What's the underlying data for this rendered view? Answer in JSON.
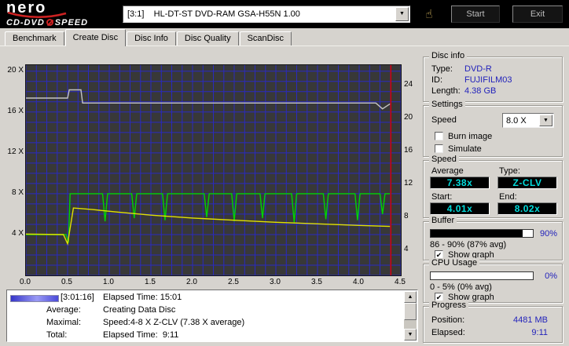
{
  "header": {
    "logo": {
      "name": "nero",
      "product_left": "CD-DVD",
      "product_right": "SPEED"
    },
    "drive_select": {
      "value": "[3:1]    HL-DT-ST DVD-RAM GSA-H55N 1.00"
    },
    "start_button": "Start",
    "exit_button": "Exit"
  },
  "icons": {
    "dropdown_arrow": "▼",
    "scroll_up": "▲",
    "scroll_down": "▼",
    "check": "✔",
    "hand": "☝"
  },
  "tabs": [
    {
      "label": "Benchmark",
      "active": false
    },
    {
      "label": "Create Disc",
      "active": true
    },
    {
      "label": "Disc Info",
      "active": false
    },
    {
      "label": "Disc Quality",
      "active": false
    },
    {
      "label": "ScanDisc",
      "active": false
    }
  ],
  "chart_data": {
    "type": "line",
    "title": "",
    "x_axis": {
      "min": 0,
      "max": 4.5,
      "step_labels": [
        0,
        0.5,
        1,
        1.5,
        2,
        2.5,
        3,
        3.5,
        4,
        4.5
      ],
      "unit": "GB"
    },
    "y_left": {
      "min": 0,
      "max": 20.6,
      "ticks": [
        20,
        16,
        12,
        8,
        4
      ],
      "suffix": " X"
    },
    "y_right": {
      "min": 1,
      "max": 26.5,
      "ticks": [
        24,
        20,
        16,
        12,
        8,
        4
      ]
    },
    "grid": {
      "x_step": 0.125,
      "y_step": 1,
      "color": "#2a2ac0"
    },
    "cursor_x": 4.38,
    "cursor_color": "#d40000",
    "series": [
      {
        "name": "buffer-level",
        "axis": "right",
        "color": "#c4c4c4",
        "points": [
          [
            0,
            22.5
          ],
          [
            0.5,
            22.5
          ],
          [
            0.52,
            23.5
          ],
          [
            0.66,
            23.5
          ],
          [
            0.68,
            21.9
          ],
          [
            4.2,
            21.9
          ],
          [
            4.28,
            21.2
          ],
          [
            4.37,
            21.8
          ]
        ]
      },
      {
        "name": "write-speed",
        "axis": "left",
        "color": "#00d400",
        "points": [
          [
            0,
            4
          ],
          [
            0.48,
            4
          ],
          [
            0.51,
            3.2
          ],
          [
            0.53,
            8
          ],
          [
            0.92,
            8
          ],
          [
            0.95,
            5.3
          ],
          [
            0.98,
            8
          ],
          [
            1.27,
            8
          ],
          [
            1.3,
            5.6
          ],
          [
            1.33,
            8
          ],
          [
            1.64,
            8
          ],
          [
            1.67,
            5.4
          ],
          [
            1.7,
            8
          ],
          [
            2.14,
            8
          ],
          [
            2.17,
            5.7
          ],
          [
            2.2,
            8
          ],
          [
            2.47,
            8
          ],
          [
            2.5,
            5.3
          ],
          [
            2.53,
            8
          ],
          [
            2.81,
            8
          ],
          [
            2.84,
            5.6
          ],
          [
            2.87,
            8
          ],
          [
            3.19,
            8
          ],
          [
            3.22,
            5.2
          ],
          [
            3.25,
            8
          ],
          [
            3.57,
            8
          ],
          [
            3.6,
            5.5
          ],
          [
            3.63,
            8
          ],
          [
            3.95,
            8
          ],
          [
            3.98,
            5.4
          ],
          [
            4.01,
            8
          ],
          [
            4.25,
            8
          ],
          [
            4.28,
            6.0
          ],
          [
            4.31,
            8
          ],
          [
            4.37,
            8
          ]
        ]
      },
      {
        "name": "average-speed",
        "axis": "left",
        "color": "#e2e200",
        "points": [
          [
            0,
            4.05
          ],
          [
            0.45,
            4.0
          ],
          [
            0.5,
            3.1
          ],
          [
            0.57,
            6.6
          ],
          [
            0.8,
            6.45
          ],
          [
            1.1,
            6.2
          ],
          [
            1.5,
            5.9
          ],
          [
            2.0,
            5.62
          ],
          [
            2.5,
            5.4
          ],
          [
            3.0,
            5.2
          ],
          [
            3.5,
            5.05
          ],
          [
            4.0,
            4.9
          ],
          [
            4.37,
            4.8
          ]
        ]
      }
    ]
  },
  "status_log": {
    "timestamp": "[3:01:16]",
    "rows": [
      {
        "label": "",
        "value": "Elapsed Time: 15:01"
      },
      {
        "label": "Average:",
        "value": "Creating Data Disc"
      },
      {
        "label": "Maximal:",
        "value": "Speed:4-8 X Z-CLV (7.38 X average)"
      },
      {
        "label": "Total:",
        "value": "Elapsed Time:  9:11"
      }
    ]
  },
  "sidebar": {
    "disc_info": {
      "title": "Disc info",
      "rows": [
        {
          "label": "Type:",
          "value": "DVD-R"
        },
        {
          "label": "ID:",
          "value": "FUJIFILM03"
        },
        {
          "label": "Length:",
          "value": "4.38 GB"
        }
      ]
    },
    "settings": {
      "title": "Settings",
      "speed_label": "Speed",
      "speed_value": "8.0 X",
      "burn_image": {
        "label": "Burn image",
        "checked": false
      },
      "simulate": {
        "label": "Simulate",
        "checked": false
      }
    },
    "speed": {
      "title": "Speed",
      "average_label": "Average",
      "average_value": "7.38x",
      "type_label": "Type:",
      "type_value": "Z-CLV",
      "start_label": "Start:",
      "start_value": "4.01x",
      "end_label": "End:",
      "end_value": "8.02x"
    },
    "buffer": {
      "title": "Buffer",
      "percent": "90%",
      "fill_percent": 90,
      "range_text": "86 - 90% (87% avg)",
      "show_graph": {
        "label": "Show graph",
        "checked": true
      }
    },
    "cpu": {
      "title": "CPU Usage",
      "percent": "0%",
      "fill_percent": 0,
      "range_text": "0 - 5% (0% avg)",
      "show_graph": {
        "label": "Show graph",
        "checked": true
      }
    },
    "progress": {
      "title": "Progress",
      "position_label": "Position:",
      "position_value": "4481 MB",
      "elapsed_label": "Elapsed:",
      "elapsed_value": "9:11"
    }
  },
  "colors": {
    "value_text": "#2222bb",
    "lcd_text": "#00dcdc",
    "chart_bg": "#383838"
  }
}
